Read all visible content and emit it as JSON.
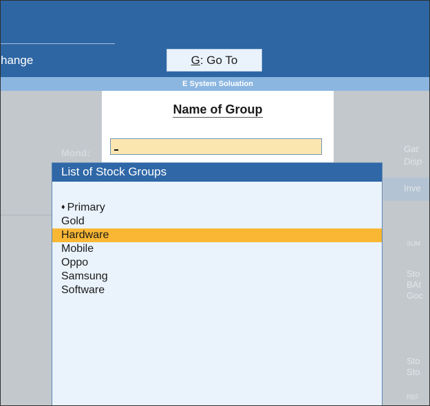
{
  "header": {
    "left_link": "hange",
    "goto_key": "G",
    "goto_label": ": Go To",
    "company": "E System Soluation"
  },
  "form": {
    "title": "Name of Group",
    "name_value": ""
  },
  "background": {
    "monday_text": "Mond:",
    "right_lines": [
      "Gat",
      "Disp",
      "Inve",
      "SUM",
      "Sto",
      "BAt",
      "Goc",
      "Sto",
      "Sto",
      "REF"
    ]
  },
  "list": {
    "title": "List of Stock Groups",
    "primary_marker": "♦",
    "items": [
      "Primary",
      "Gold",
      "Hardware",
      "Mobile",
      "Oppo",
      "Samsung",
      "Software"
    ],
    "selected_index": 2
  },
  "colors": {
    "header_blue": "#2d66a3",
    "list_header_blue": "#2f67a7",
    "selection_orange": "#f9b733",
    "input_fill": "#fbe6b0"
  }
}
